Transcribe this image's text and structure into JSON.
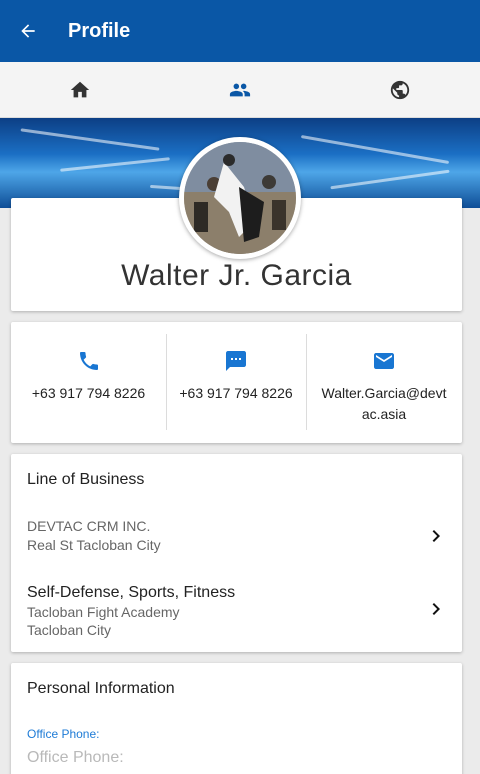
{
  "appbar": {
    "title": "Profile",
    "back_icon": "arrow-left-icon"
  },
  "tabs": [
    {
      "icon": "home-icon"
    },
    {
      "icon": "people-icon"
    },
    {
      "icon": "globe-icon"
    }
  ],
  "profile": {
    "name": "Walter Jr. Garcia"
  },
  "contacts": [
    {
      "icon": "phone-icon",
      "text": "+63 917 794 8226"
    },
    {
      "icon": "message-icon",
      "text": "+63 917 794 8226"
    },
    {
      "icon": "email-icon",
      "text": "Walter.Garcia@devtac.asia"
    }
  ],
  "business": {
    "title": "Line of Business",
    "items": [
      {
        "line1": "DEVTAC CRM INC.",
        "line2": "Real St Tacloban City"
      },
      {
        "line1": "Self-Defense, Sports, Fitness",
        "line2": "Tacloban Fight Academy",
        "line3": "Tacloban City"
      }
    ]
  },
  "personal": {
    "title": "Personal Information",
    "office_phone_label": "Office Phone:",
    "office_phone_placeholder": "Office Phone:"
  },
  "colors": {
    "appbar": "#0a57a6",
    "accent": "#1e7bd6",
    "icon_blue": "#1976d2"
  }
}
